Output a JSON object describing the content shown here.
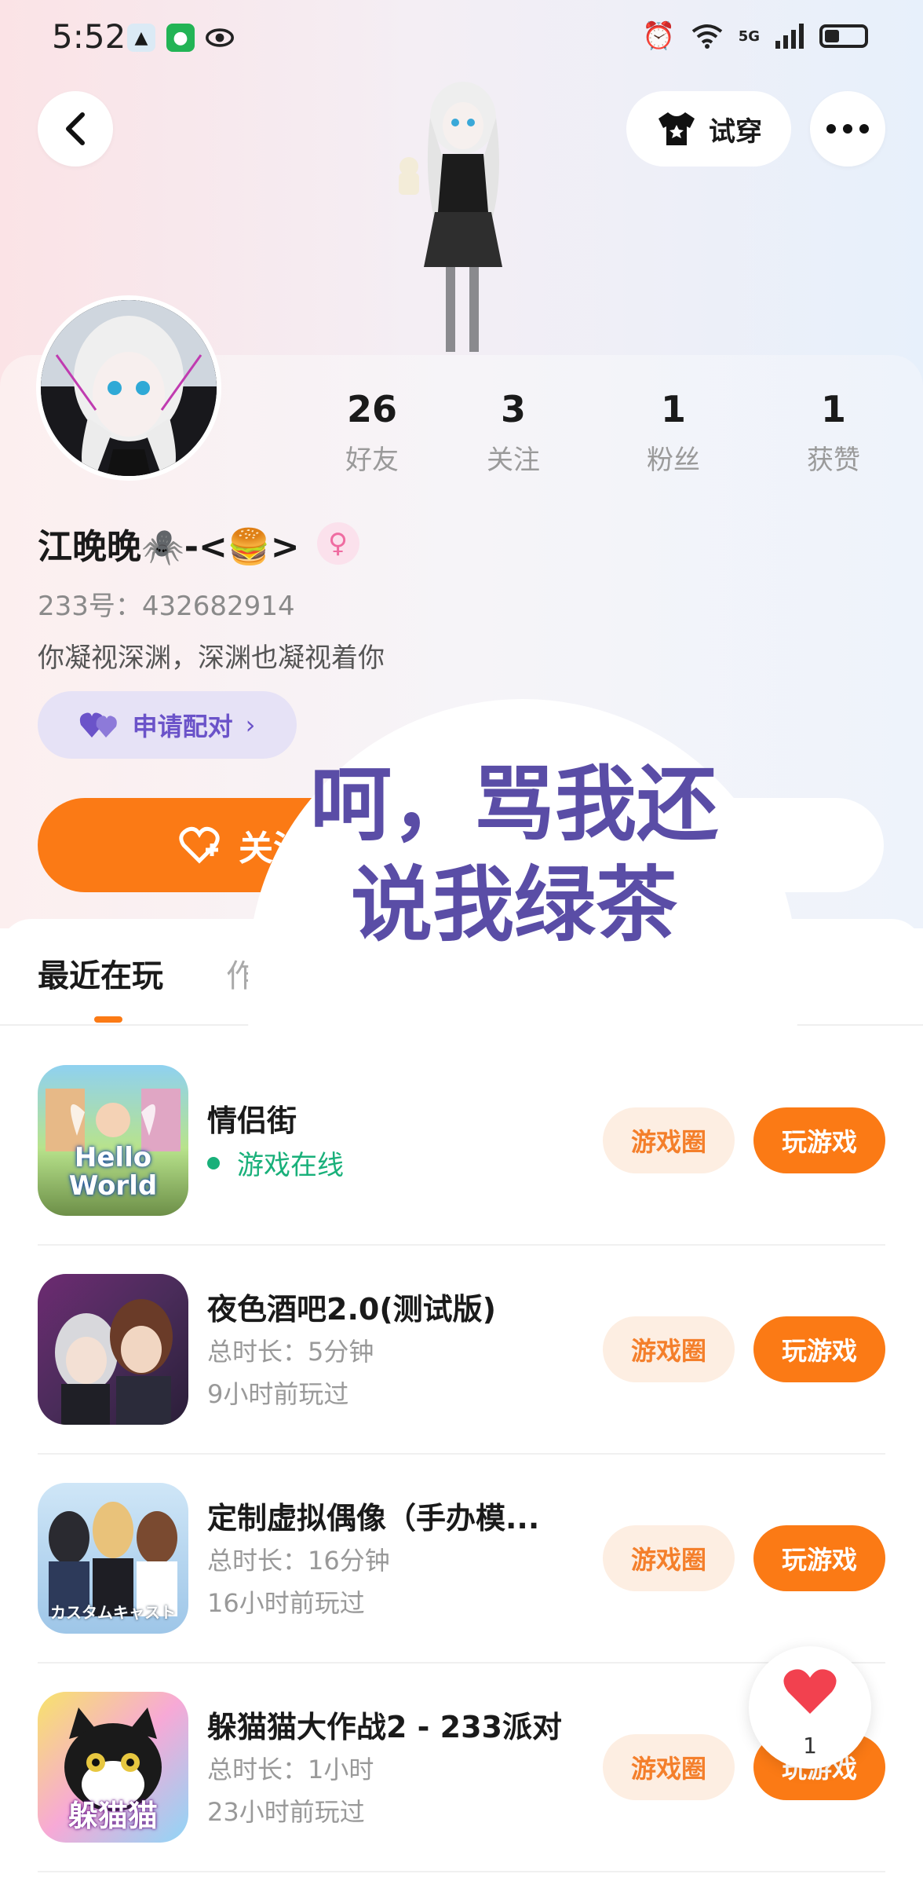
{
  "status_bar": {
    "time": "5:52",
    "network": "5G"
  },
  "header": {
    "try_on_label": "试穿"
  },
  "profile": {
    "stats": [
      {
        "value": "26",
        "label": "好友"
      },
      {
        "value": "3",
        "label": "关注"
      },
      {
        "value": "1",
        "label": "粉丝"
      },
      {
        "value": "1",
        "label": "获赞"
      }
    ],
    "nickname": "江晚晚🕷️-<🍔>",
    "gender_symbol": "♀",
    "uid": "233号：432682914",
    "bio": "你凝视深渊，深渊也凝视着你",
    "pair_button": "申请配对",
    "add_friend_label": "关注"
  },
  "overlay": {
    "bubble_text": "呵，骂我还说我绿茶"
  },
  "tabs": {
    "active": "最近在玩",
    "inactive": "作"
  },
  "games": [
    {
      "title": "情侣街",
      "online": "游戏在线",
      "circle_label": "游戏圈",
      "play_label": "玩游戏",
      "icon_text": "Hello World"
    },
    {
      "title": "夜色酒吧2.0(测试版)",
      "duration": "总时长：5分钟",
      "last_played": "9小时前玩过",
      "circle_label": "游戏圈",
      "play_label": "玩游戏"
    },
    {
      "title": "定制虚拟偶像（手办模...",
      "duration": "总时长：16分钟",
      "last_played": "16小时前玩过",
      "circle_label": "游戏圈",
      "play_label": "玩游戏",
      "icon_text": "カスタムキャスト"
    },
    {
      "title": "躲猫猫大作战2 - 233派对",
      "duration": "总时长：1小时",
      "last_played": "23小时前玩过",
      "circle_label": "游戏圈",
      "play_label": "玩游戏",
      "icon_text": "躲猫猫"
    }
  ],
  "like_float": {
    "count": "1"
  },
  "colors": {
    "accent": "#fb7a15",
    "online": "#19b07a",
    "pair": "#6b53c9"
  }
}
